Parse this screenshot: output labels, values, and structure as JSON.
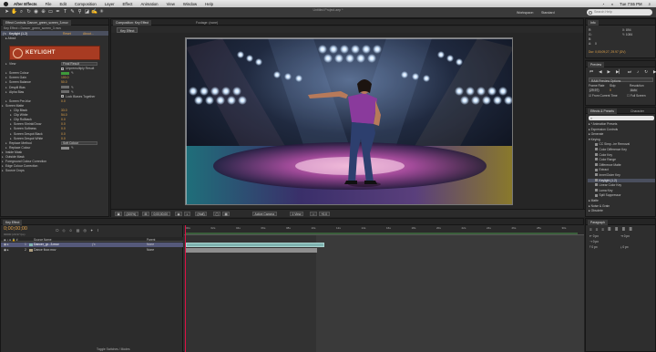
{
  "menubar": {
    "items": [
      "After Effects",
      "File",
      "Edit",
      "Composition",
      "Layer",
      "Effect",
      "Animation",
      "View",
      "Window",
      "Help"
    ],
    "clock": "Tue 7:55 PM"
  },
  "toolbar": {
    "doc_title": "Untitled Project.aep *",
    "workspace_label": "Workspace:",
    "workspace_value": "Standard",
    "search_placeholder": "Search Help"
  },
  "effect_controls": {
    "tab_label": "Effect Controls: Dancer_green_screen_3.mov",
    "breadcrumb": "Key Effect • Dancer_green_screen_3.mov",
    "effect_name": "Keylight (1.2)",
    "reset_label": "Reset",
    "about_label": "About...",
    "about_row": "About",
    "logo_text": "KEYLIGHT",
    "rows": [
      {
        "label": "View",
        "value": "Final Result",
        "kind": "dropdown"
      },
      {
        "label": "",
        "value": "Unpremultiply Result",
        "kind": "checkbox"
      },
      {
        "label": "Screen Colour",
        "value": "",
        "kind": "swatch",
        "color": "#3f9a3a"
      },
      {
        "label": "Screen Gain",
        "value": "100.0",
        "kind": "value"
      },
      {
        "label": "Screen Balance",
        "value": "50.0",
        "kind": "value"
      },
      {
        "label": "Despill Bias",
        "value": "",
        "kind": "swatch",
        "color": "#6d6d6d"
      },
      {
        "label": "Alpha Bias",
        "value": "",
        "kind": "swatch",
        "color": "#6d6d6d"
      },
      {
        "label": "",
        "value": "Lock Biases Together",
        "kind": "checkbox"
      },
      {
        "label": "Screen Pre-blur",
        "value": "0.0",
        "kind": "value"
      },
      {
        "label": "Screen Matte",
        "value": "",
        "kind": "group"
      },
      {
        "label": "Clip Black",
        "value": "33.0",
        "kind": "value"
      },
      {
        "label": "Clip White",
        "value": "54.0",
        "kind": "value"
      },
      {
        "label": "Clip Rollback",
        "value": "0.0",
        "kind": "value"
      },
      {
        "label": "Screen Shrink/Grow",
        "value": "0.0",
        "kind": "value"
      },
      {
        "label": "Screen Softness",
        "value": "0.0",
        "kind": "value"
      },
      {
        "label": "Screen Despot Black",
        "value": "0.0",
        "kind": "value"
      },
      {
        "label": "Screen Despot White",
        "value": "0.0",
        "kind": "value"
      },
      {
        "label": "Replace Method",
        "value": "Soft Colour",
        "kind": "dropdown"
      },
      {
        "label": "Replace Colour",
        "value": "",
        "kind": "swatch",
        "color": "#8a8a8a"
      },
      {
        "label": "Inside Mask",
        "value": "",
        "kind": "group"
      },
      {
        "label": "Outside Mask",
        "value": "",
        "kind": "group"
      },
      {
        "label": "Foreground Colour Correction",
        "value": "",
        "kind": "group"
      },
      {
        "label": "Edge Colour Correction",
        "value": "",
        "kind": "group"
      },
      {
        "label": "Source Crops",
        "value": "",
        "kind": "group"
      }
    ]
  },
  "composition": {
    "tab_label": "Composition: Key Effect",
    "layer_tab": "Footage: (none)",
    "sub_tab": "Key Effect",
    "footer": [
      "(100%)",
      "0;00;00;00",
      "(Half)",
      "Active Camera",
      "1 View",
      "+0.0"
    ]
  },
  "info": {
    "tab_label": "Info",
    "r": "R:",
    "g": "G:",
    "b": "B:",
    "a": "A:",
    "r_val": "",
    "g_val": "",
    "b_val": "",
    "a_val": "0",
    "x": "X: 894",
    "y": "Y: 1084",
    "timecode_line": "Dur: 0;00;09;27, 29.97 (DV)"
  },
  "preview": {
    "tab_label": "Preview",
    "ram_options": "RAM Preview Options",
    "frame_rate_label": "Frame Rate",
    "skip_label": "Skip",
    "resolution_label": "Resolution",
    "frame_rate_value": "(29.97)",
    "skip_value": "0",
    "resolution_value": "Auto",
    "from_current": "From Current Time",
    "full_screen": "Full Screen"
  },
  "effects_presets": {
    "tab_label": "Effects & Presets",
    "tab2_label": "Character",
    "search_value": "",
    "items": [
      {
        "label": "* Animation Presets",
        "kind": "folder"
      },
      {
        "label": "Expression Controls",
        "kind": "folder"
      },
      {
        "label": "Generate",
        "kind": "folder"
      },
      {
        "label": "Keying",
        "kind": "folder-open"
      },
      {
        "label": "CC Simp...ire Removal",
        "kind": "fx"
      },
      {
        "label": "Color Difference Key",
        "kind": "fx"
      },
      {
        "label": "Color Key",
        "kind": "fx"
      },
      {
        "label": "Color Range",
        "kind": "fx"
      },
      {
        "label": "Difference Matte",
        "kind": "fx"
      },
      {
        "label": "Extract",
        "kind": "fx"
      },
      {
        "label": "Inner/Outer Key",
        "kind": "fx"
      },
      {
        "label": "Keylight (1.2)",
        "kind": "fx-sel"
      },
      {
        "label": "Linear Color Key",
        "kind": "fx"
      },
      {
        "label": "Luma Key",
        "kind": "fx"
      },
      {
        "label": "Spill Suppressor",
        "kind": "fx"
      },
      {
        "label": "Matte",
        "kind": "folder"
      },
      {
        "label": "Noise & Grain",
        "kind": "folder"
      },
      {
        "label": "Obsolete",
        "kind": "folder"
      }
    ]
  },
  "paragraph": {
    "tab_label": "Paragraph",
    "fields": [
      "0 px",
      "0 px",
      "0 px",
      "0 px",
      "0 px"
    ]
  },
  "timeline": {
    "tab_label": "Key Effect",
    "timecode": "0;00;00;00",
    "frame_info": "00000 (29.97 fps)",
    "col_source": "Source Name",
    "col_parent": "Parent",
    "layers": [
      {
        "num": "1",
        "name": "Dancer_gr...3.mov",
        "parent": "None",
        "selected": true
      },
      {
        "num": "2",
        "name": "Dance floor.mov",
        "parent": "None",
        "selected": false
      }
    ],
    "ruler": [
      "00s",
      "02s",
      "04s",
      "06s",
      "08s",
      "10s",
      "12s",
      "14s",
      "16s",
      "18s",
      "20s",
      "22s",
      "24s",
      "26s",
      "28s",
      "30s"
    ],
    "footer": "Toggle Switches / Modes"
  },
  "colors": {
    "accent_value": "#e0a24a",
    "selection": "#4a4f5e",
    "layer_bar": "#7fb3b0",
    "work_area": "#3b5f3c"
  }
}
